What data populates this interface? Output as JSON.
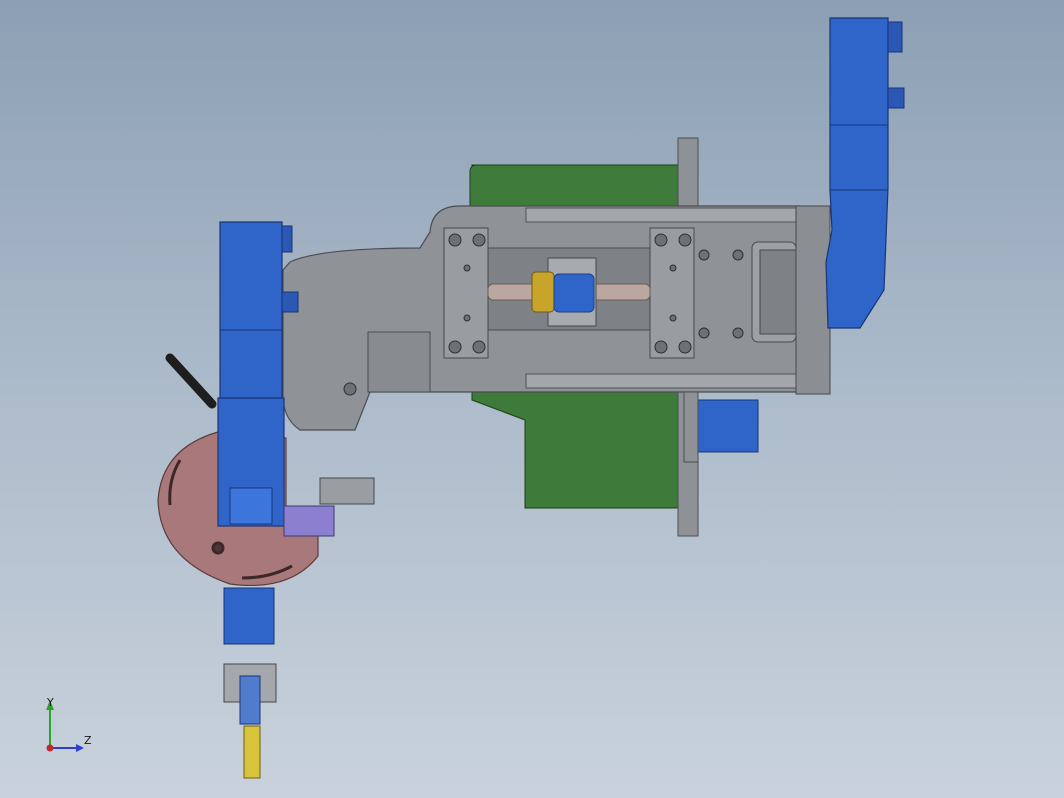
{
  "viewport": {
    "background_top": "#8c9fb4",
    "background_bottom": "#c9d2dc"
  },
  "colors": {
    "steel": "#8f9296",
    "steel_dark": "#55585c",
    "blue": "#2f64c9",
    "blue_dark": "#1d3f8a",
    "green": "#3e7a3a",
    "copper": "#a9787a",
    "gold": "#c8a42a",
    "yellow": "#d8c43a",
    "rod": "#b9a7a0"
  },
  "triad": {
    "y_label": "Y",
    "z_label": "Z",
    "y_color": "#2aa52a",
    "z_color": "#2a3fd0",
    "x_color": "#c0282a"
  }
}
